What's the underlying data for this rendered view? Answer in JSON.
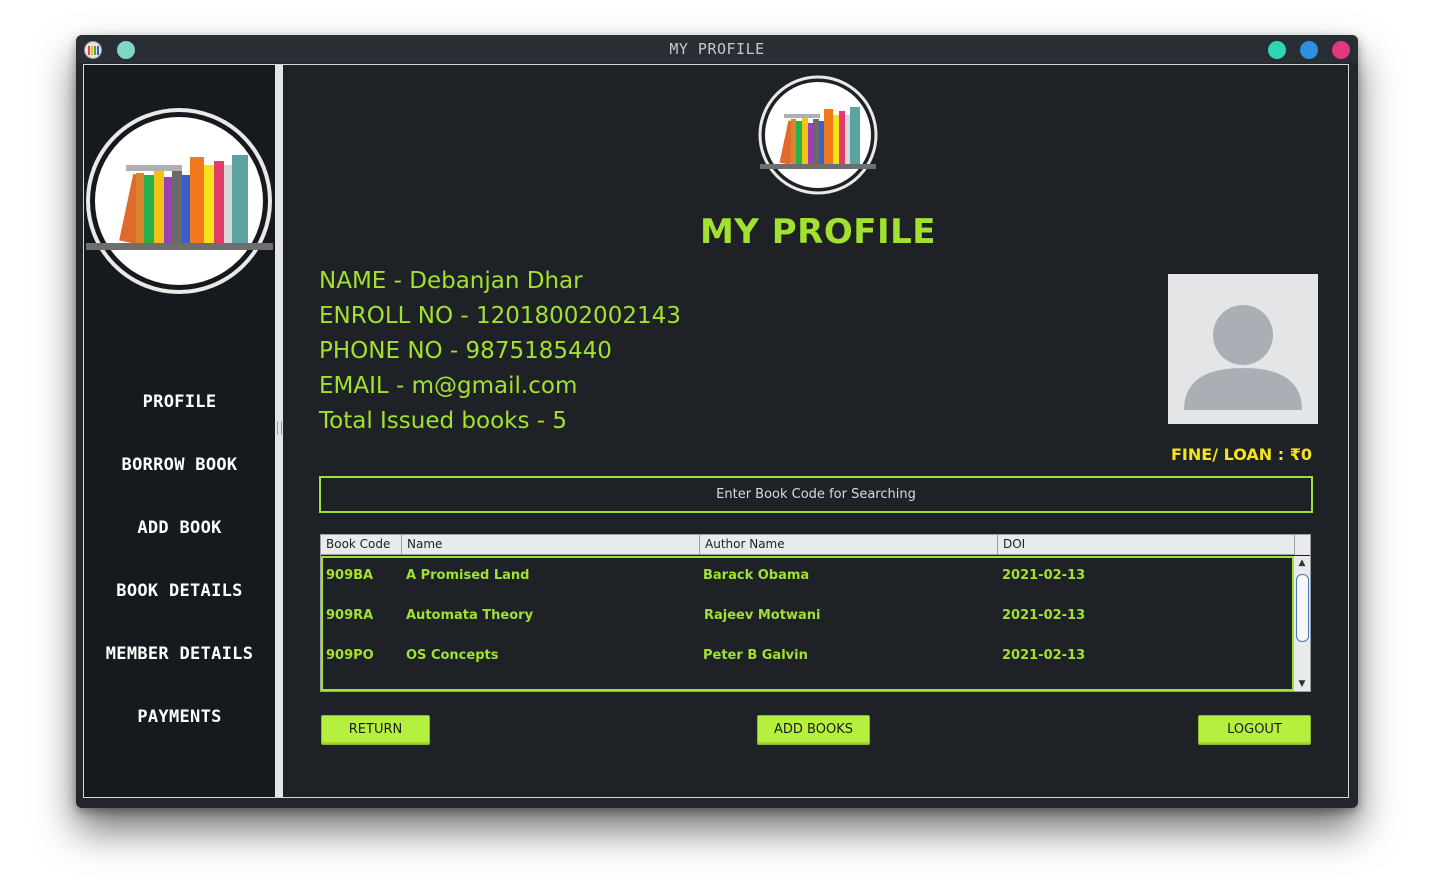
{
  "window": {
    "title": "MY PROFILE",
    "titlebar_dots": [
      "#2fd6b4",
      "#2f8fe0",
      "#e2377f"
    ],
    "extra_dot": "#7fd6c4"
  },
  "sidebar": {
    "items": [
      {
        "label": "PROFILE"
      },
      {
        "label": "BORROW BOOK"
      },
      {
        "label": "ADD BOOK"
      },
      {
        "label": "BOOK DETAILS"
      },
      {
        "label": "MEMBER DETAILS"
      },
      {
        "label": "PAYMENTS"
      }
    ]
  },
  "main": {
    "title": "MY PROFILE",
    "profile": {
      "name": "NAME - Debanjan Dhar",
      "enroll": "ENROLL NO - 12018002002143",
      "phone": "PHONE NO - 9875185440",
      "email": "EMAIL - m@gmail.com",
      "issued": "Total Issued books - 5"
    },
    "fine": "FINE/ LOAN : ₹0",
    "search": {
      "placeholder": "Enter Book Code for Searching",
      "value": ""
    },
    "table": {
      "columns": [
        "Book Code",
        "Name",
        "Author Name",
        "DOI"
      ],
      "rows": [
        [
          "909BA",
          "A Promised Land",
          "Barack Obama",
          "2021-02-13"
        ],
        [
          "909RA",
          "Automata Theory",
          "Rajeev Motwani",
          "2021-02-13"
        ],
        [
          "909PO",
          "OS Concepts",
          "Peter B Galvin",
          "2021-02-13"
        ]
      ]
    },
    "buttons": {
      "return": "RETURN",
      "add_books": "ADD BOOKS",
      "logout": "LOGOUT"
    }
  },
  "colors": {
    "accent": "#a2e12f",
    "fine": "#f5e61a",
    "button": "#b6f03f",
    "background": "#1e2227",
    "sidebar": "#16191d"
  },
  "icons": {
    "app": "app-icon",
    "logo": "books-logo",
    "avatar": "user-avatar-icon"
  }
}
